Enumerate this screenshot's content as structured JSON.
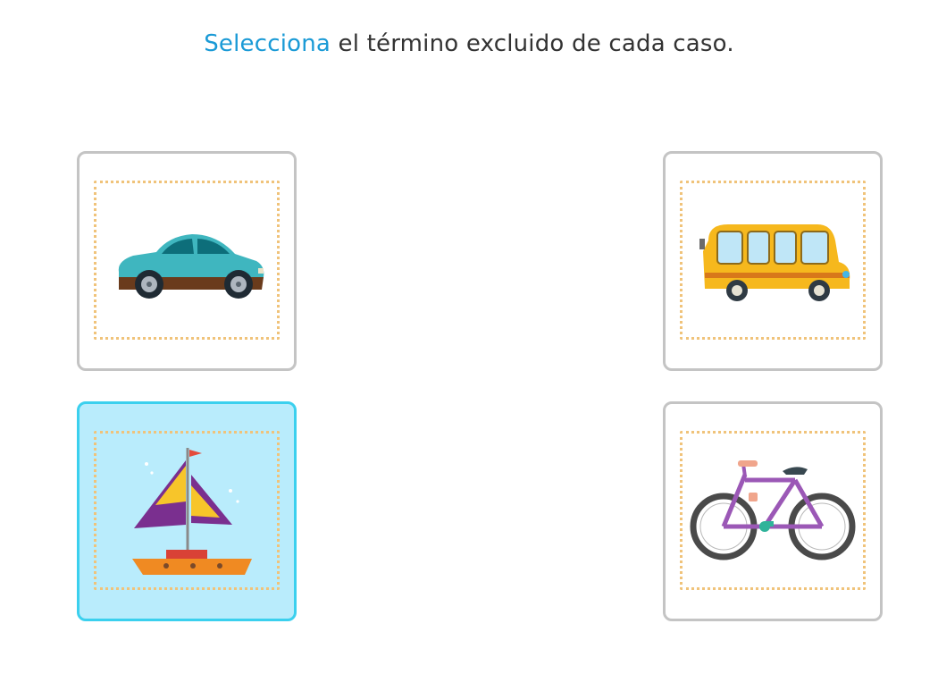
{
  "instruction": {
    "highlight": "Selecciona",
    "rest": " el término excluido de cada caso."
  },
  "colors": {
    "accent": "#1a9ad6",
    "selected_background": "#b9ecfc",
    "selected_border": "#3bd0ee",
    "card_border": "#c4c4c4",
    "frame_dots": "#f0c37a"
  },
  "options": [
    {
      "icon": "car-icon",
      "selected": false
    },
    {
      "icon": "bus-icon",
      "selected": false
    },
    {
      "icon": "sailboat-icon",
      "selected": true
    },
    {
      "icon": "bicycle-icon",
      "selected": false
    }
  ]
}
